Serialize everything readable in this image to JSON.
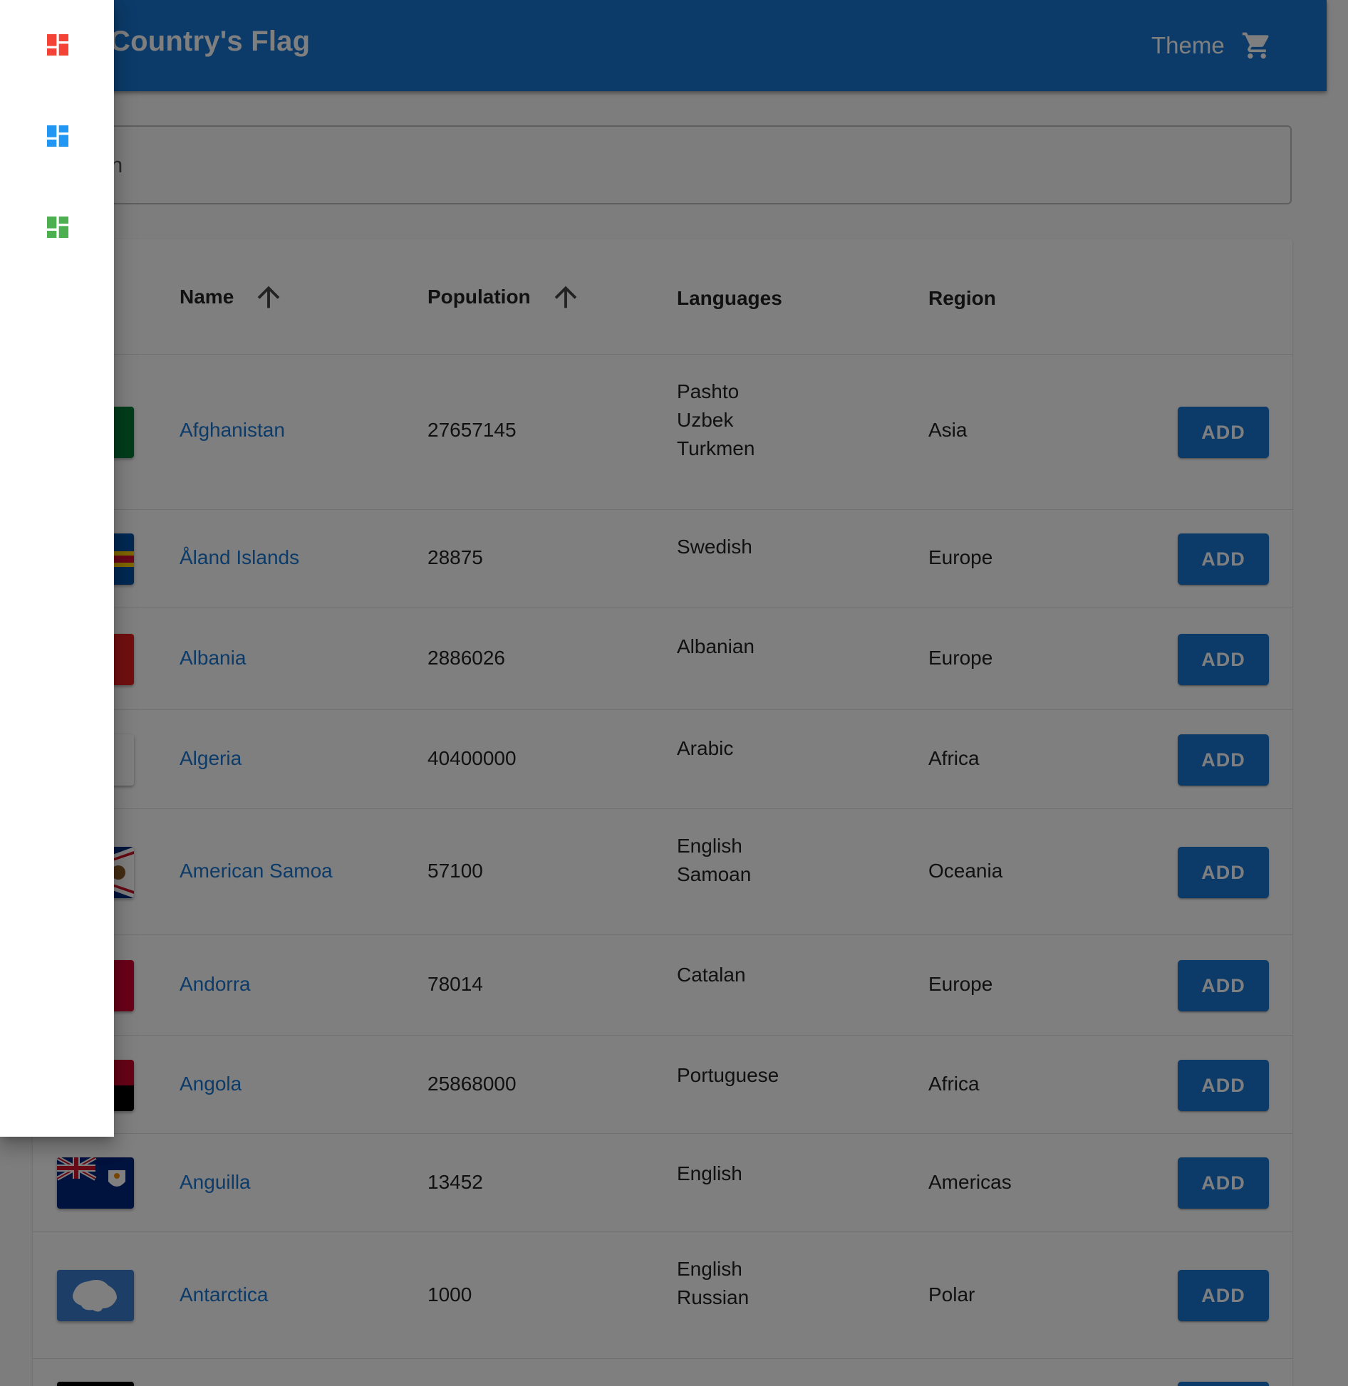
{
  "app": {
    "title": "Country's Flag",
    "theme_label": "Theme",
    "cart_icon": "shopping-cart-icon"
  },
  "search": {
    "placeholder": "Search",
    "value": ""
  },
  "table": {
    "headers": {
      "name": "Name",
      "population": "Population",
      "languages": "Languages",
      "region": "Region"
    },
    "sort_icons": {
      "name": "arrow-upward-icon",
      "population": "arrow-upward-icon"
    },
    "add_label": "ADD",
    "rows": [
      {
        "name": "Afghanistan",
        "population": "27657145",
        "languages": [
          "Pashto",
          "Uzbek",
          "Turkmen"
        ],
        "region": "Asia"
      },
      {
        "name": "Åland Islands",
        "population": "28875",
        "languages": [
          "Swedish"
        ],
        "region": "Europe"
      },
      {
        "name": "Albania",
        "population": "2886026",
        "languages": [
          "Albanian"
        ],
        "region": "Europe"
      },
      {
        "name": "Algeria",
        "population": "40400000",
        "languages": [
          "Arabic"
        ],
        "region": "Africa"
      },
      {
        "name": "American Samoa",
        "population": "57100",
        "languages": [
          "English",
          "Samoan"
        ],
        "region": "Oceania"
      },
      {
        "name": "Andorra",
        "population": "78014",
        "languages": [
          "Catalan"
        ],
        "region": "Europe"
      },
      {
        "name": "Angola",
        "population": "25868000",
        "languages": [
          "Portuguese"
        ],
        "region": "Africa"
      },
      {
        "name": "Anguilla",
        "population": "13452",
        "languages": [
          "English"
        ],
        "region": "Americas"
      },
      {
        "name": "Antarctica",
        "population": "1000",
        "languages": [
          "English",
          "Russian"
        ],
        "region": "Polar"
      }
    ]
  },
  "drawer": {
    "items": [
      {
        "icon": "dashboard-icon",
        "color": "#f44336"
      },
      {
        "icon": "dashboard-icon",
        "color": "#2196f3"
      },
      {
        "icon": "dashboard-icon",
        "color": "#4caf50"
      }
    ]
  },
  "colors": {
    "primary": "#1976d2",
    "link": "#1976d2"
  }
}
